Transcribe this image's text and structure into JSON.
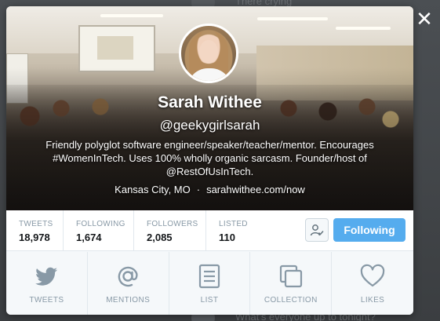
{
  "background": {
    "top_snippet": "There crying",
    "bottom_snippet": "What's everyone up to tonight?"
  },
  "profile": {
    "name": "Sarah Withee",
    "handle": "@geekygirlsarah",
    "bio": "Friendly polyglot software engineer/speaker/teacher/mentor. Encourages #WomenInTech. Uses 100% wholly organic sarcasm. Founder/host of @RestOfUsInTech.",
    "location": "Kansas City, MO",
    "separator": "·",
    "website": "sarahwithee.com/now"
  },
  "stats": [
    {
      "label": "TWEETS",
      "value": "18,978"
    },
    {
      "label": "FOLLOWING",
      "value": "1,674"
    },
    {
      "label": "FOLLOWERS",
      "value": "2,085"
    },
    {
      "label": "LISTED",
      "value": "110"
    }
  ],
  "follow": {
    "button_label": "Following",
    "user_menu_icon": "user-check-icon"
  },
  "tabs": [
    {
      "label": "TWEETS",
      "icon": "twitter-bird-icon"
    },
    {
      "label": "MENTIONS",
      "icon": "at-sign-icon"
    },
    {
      "label": "LIST",
      "icon": "list-icon"
    },
    {
      "label": "COLLECTION",
      "icon": "collection-icon"
    },
    {
      "label": "LIKES",
      "icon": "heart-icon"
    }
  ],
  "close_icon": "close-icon",
  "colors": {
    "accent": "#55acee",
    "icon_gray": "#8899a6",
    "modal_bg": "#f5f8fa"
  }
}
